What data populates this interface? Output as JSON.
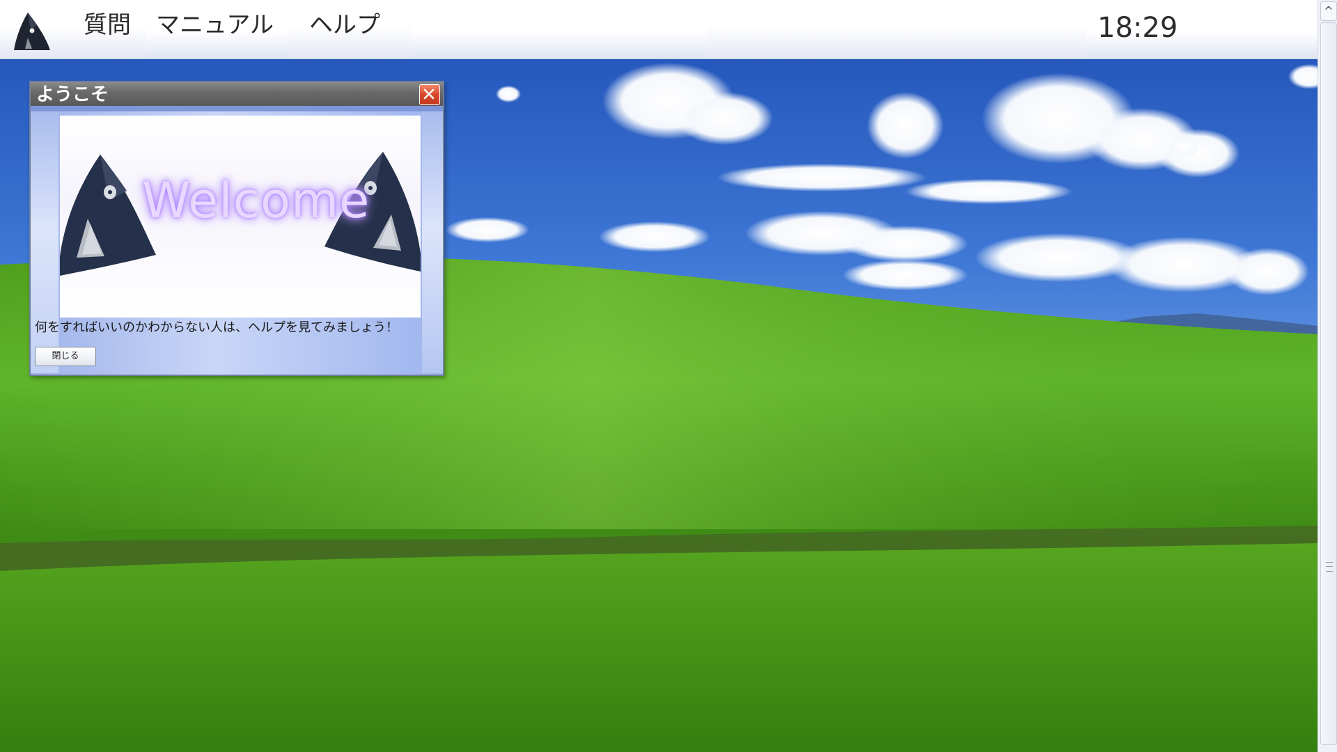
{
  "menubar": {
    "items": [
      {
        "label": "質問"
      },
      {
        "label": "マニュアル"
      },
      {
        "label": "ヘルプ"
      }
    ],
    "clock": "18:29",
    "logo_icon": "hooded-figure-logo-icon"
  },
  "dialog": {
    "title": "ようこそ",
    "banner_text": "Welcome",
    "message": "何をすればいいのかわからない人は、ヘルプを見てみましょう！",
    "close_button": "閉じる",
    "close_icon": "close-x-icon"
  },
  "scrollbar": {
    "up_arrow": "^"
  },
  "colors": {
    "title_bar": "#6b6b6b",
    "close_button": "#d8472a",
    "dialog_body": "#c9d6f7",
    "welcome_glow": "#a679ff"
  }
}
